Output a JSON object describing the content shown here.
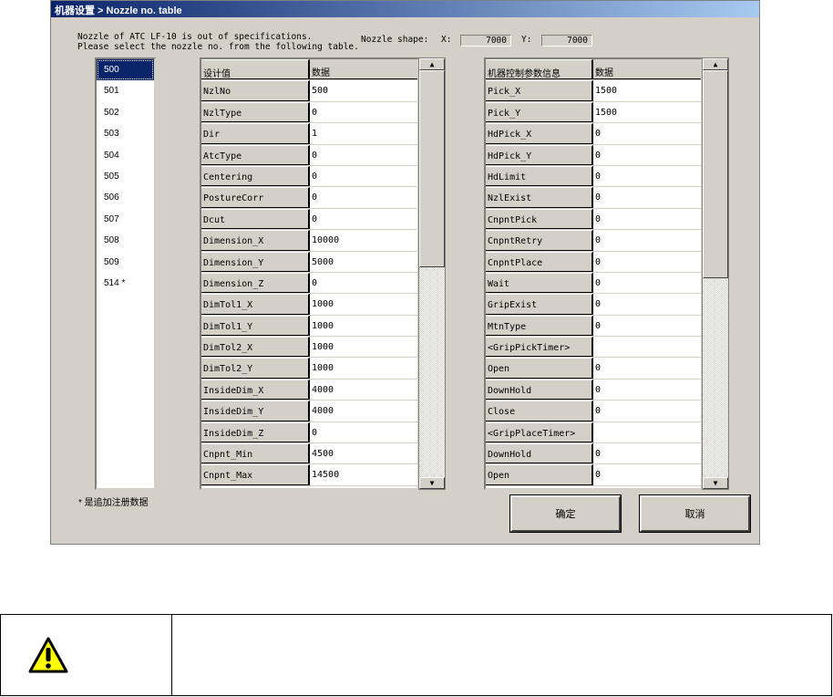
{
  "window": {
    "title": "机器设置 > Nozzle no. table"
  },
  "message": [
    "Nozzle of ATC LF-10 is out of specifications.",
    "Please select the nozzle no. from the following table."
  ],
  "nozzle_shape": {
    "label": "Nozzle shape:",
    "x_label": "X:",
    "x_value": "7000",
    "y_label": "Y:",
    "y_value": "7000"
  },
  "nozzle_list": {
    "items": [
      "500",
      "501",
      "502",
      "503",
      "504",
      "505",
      "506",
      "507",
      "508",
      "509",
      "514 *"
    ],
    "selected": "500"
  },
  "note": "* 是追加注册数据",
  "design_table": {
    "headers": [
      "设计值",
      "数据"
    ],
    "rows": [
      [
        "NzlNo",
        "500"
      ],
      [
        "NzlType",
        "0"
      ],
      [
        "Dir",
        "1"
      ],
      [
        "AtcType",
        "0"
      ],
      [
        "Centering",
        "0"
      ],
      [
        "PostureCorr",
        "0"
      ],
      [
        "Dcut",
        "0"
      ],
      [
        "Dimension_X",
        "10000"
      ],
      [
        "Dimension_Y",
        "5000"
      ],
      [
        "Dimension_Z",
        "0"
      ],
      [
        "DimTol1_X",
        "1000"
      ],
      [
        "DimTol1_Y",
        "1000"
      ],
      [
        "DimTol2_X",
        "1000"
      ],
      [
        "DimTol2_Y",
        "1000"
      ],
      [
        "InsideDim_X",
        "4000"
      ],
      [
        "InsideDim_Y",
        "4000"
      ],
      [
        "InsideDim_Z",
        "0"
      ],
      [
        "Cnpnt_Min",
        "4500"
      ],
      [
        "Cnpnt_Max",
        "14500"
      ]
    ]
  },
  "machine_table": {
    "headers": [
      "机器控制参数信息",
      "数据"
    ],
    "rows": [
      [
        "Pick_X",
        "1500"
      ],
      [
        "Pick_Y",
        "1500"
      ],
      [
        "HdPick_X",
        "0"
      ],
      [
        "HdPick_Y",
        "0"
      ],
      [
        "HdLimit",
        "0"
      ],
      [
        "NzlExist",
        "0"
      ],
      [
        "CnpntPick",
        "0"
      ],
      [
        "CnpntRetry",
        "0"
      ],
      [
        "CnpntPlace",
        "0"
      ],
      [
        "Wait",
        "0"
      ],
      [
        "GripExist",
        "0"
      ],
      [
        "MtnType",
        "0"
      ],
      [
        "<GripPickTimer>",
        ""
      ],
      [
        "Open",
        "0"
      ],
      [
        "DownHold",
        "0"
      ],
      [
        "Close",
        "0"
      ],
      [
        "<GripPlaceTimer>",
        ""
      ],
      [
        "DownHold",
        "0"
      ],
      [
        "Open",
        "0"
      ]
    ]
  },
  "buttons": {
    "ok": "确定",
    "cancel": "取消"
  },
  "warning": {
    "icon": "warning-triangle-icon",
    "color": "#ffff00"
  }
}
